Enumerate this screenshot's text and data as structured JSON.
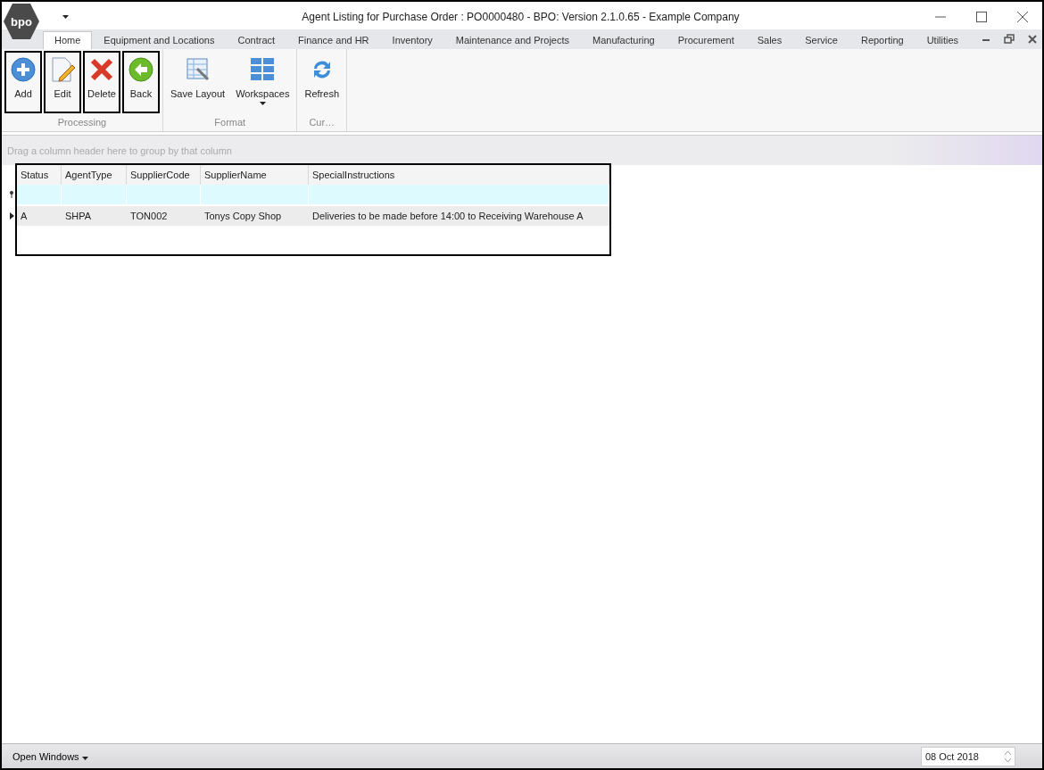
{
  "window": {
    "title": "Agent Listing for Purchase Order : PO0000480 - BPO: Version 2.1.0.65 - Example Company",
    "logo": "bpo"
  },
  "tabs": [
    {
      "label": "Home",
      "selected": true
    },
    {
      "label": "Equipment and Locations",
      "selected": false
    },
    {
      "label": "Contract",
      "selected": false
    },
    {
      "label": "Finance and HR",
      "selected": false
    },
    {
      "label": "Inventory",
      "selected": false
    },
    {
      "label": "Maintenance and Projects",
      "selected": false
    },
    {
      "label": "Manufacturing",
      "selected": false
    },
    {
      "label": "Procurement",
      "selected": false
    },
    {
      "label": "Sales",
      "selected": false
    },
    {
      "label": "Service",
      "selected": false
    },
    {
      "label": "Reporting",
      "selected": false
    },
    {
      "label": "Utilities",
      "selected": false
    }
  ],
  "ribbon_groups": [
    {
      "label": "Processing",
      "buttons": [
        {
          "label": "Add",
          "kind": "add",
          "highlighted": true
        },
        {
          "label": "Edit",
          "kind": "edit",
          "highlighted": true
        },
        {
          "label": "Delete",
          "kind": "delete",
          "highlighted": true
        },
        {
          "label": "Back",
          "kind": "back",
          "highlighted": true
        }
      ]
    },
    {
      "label": "Format",
      "buttons": [
        {
          "label": "Save Layout",
          "kind": "layout",
          "highlighted": false
        },
        {
          "label": "Workspaces",
          "kind": "workspaces",
          "highlighted": false
        }
      ]
    },
    {
      "label": "Cur…",
      "buttons": [
        {
          "label": "Refresh",
          "kind": "refresh",
          "highlighted": false
        }
      ]
    }
  ],
  "grid": {
    "group_hint": "Drag a column header here to group by that column",
    "highlighted": true,
    "columns": [
      "Status",
      "AgentType",
      "SupplierCode",
      "SupplierName",
      "SpecialInstructions"
    ],
    "rows": [
      [
        "A",
        "SHPA",
        "TON002",
        "Tonys Copy Shop",
        "Deliveries to be made before 14:00 to Receiving Warehouse A"
      ]
    ]
  },
  "status_bar": {
    "open_windows": "Open Windows",
    "date": "08 Oct 2018"
  }
}
